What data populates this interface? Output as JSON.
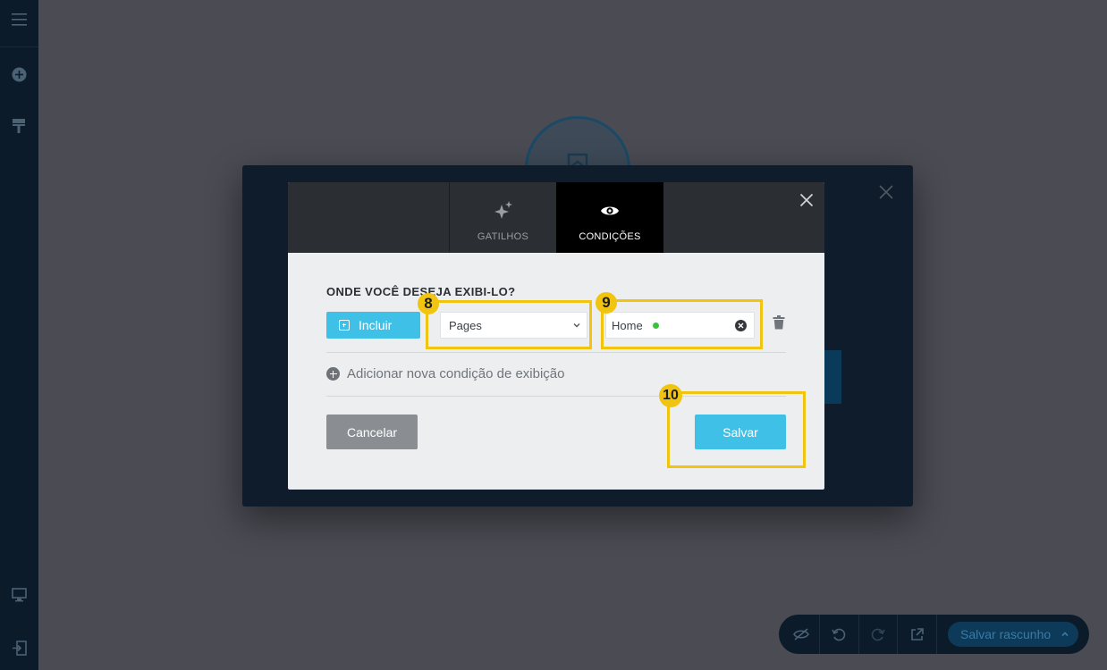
{
  "modal": {
    "tabs": [
      {
        "label": "GATILHOS",
        "icon": "sparkles-icon"
      },
      {
        "label": "CONDIÇÕES",
        "icon": "eye-icon",
        "active": true
      }
    ],
    "section_title": "ONDE VOCÊ DESEJA EXIBI-LO?",
    "include_button": "Incluir",
    "page_type_select": {
      "selected": "Pages"
    },
    "page_tag": {
      "value": "Home"
    },
    "add_condition": "Adicionar nova condição de exibição",
    "cancel_button": "Cancelar",
    "save_button": "Salvar"
  },
  "annotations": {
    "step_8": "8",
    "step_9": "9",
    "step_10": "10",
    "highlight_color": "#f1c40f"
  },
  "toolbar": {
    "save_draft": "Salvar rascunho"
  },
  "colors": {
    "accent": "#3fc0e6",
    "sidebar": "#0c1b2a",
    "status_dot": "#3ac33a"
  }
}
